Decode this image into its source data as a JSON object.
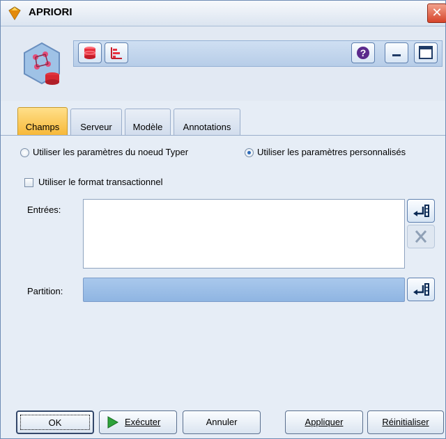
{
  "window": {
    "title": "APRIORI"
  },
  "titlebar": {
    "close_glyph": "✕"
  },
  "toolbar": {
    "help_glyph": "?"
  },
  "tabs": [
    {
      "label": "Champs",
      "active": true
    },
    {
      "label": "Serveur",
      "active": false
    },
    {
      "label": "Modèle",
      "active": false
    },
    {
      "label": "Annotations",
      "active": false
    }
  ],
  "settings": {
    "radio_type_node": "Utiliser les paramètres du noeud Typer",
    "radio_custom": "Utiliser les paramètres personnalisés",
    "custom_selected": true,
    "checkbox_transactional": "Utiliser le format transactionnel",
    "transactional_checked": false
  },
  "fields": {
    "inputs_label": "Entrées:",
    "inputs_values": [],
    "partition_label": "Partition:",
    "partition_value": ""
  },
  "buttons": {
    "ok": "OK",
    "execute": "Exécuter",
    "cancel": "Annuler",
    "apply": "Appliquer",
    "reset": "Réinitialiser"
  },
  "colors": {
    "accent": "#f7b93a",
    "selection": "#8fb5e2"
  }
}
